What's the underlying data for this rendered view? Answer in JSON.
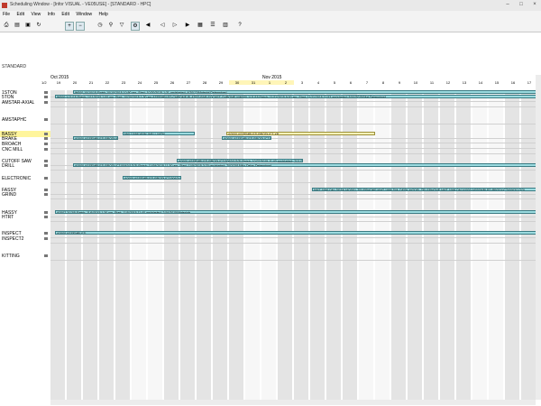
{
  "app": {
    "title": "Scheduling Window - [Infor VISUAL - VE05USE] - [STANDARD - HPC]"
  },
  "window_controls": {
    "minimize": "–",
    "maximize": "□",
    "close": "×"
  },
  "menu": [
    "File",
    "Edit",
    "View",
    "Info",
    "Edit",
    "Window",
    "Help"
  ],
  "toolbar": {
    "icons": [
      "print",
      "open",
      "save",
      "refresh",
      "zoom-in",
      "zoom-out",
      "back",
      "forward",
      "find",
      "help"
    ],
    "help_glyph": "?"
  },
  "calendar": {
    "label": "STANDARD",
    "scale": "1/2",
    "months": [
      {
        "name": "Oct 2015"
      },
      {
        "name": "Nov 2015"
      }
    ],
    "days": [
      "19",
      "20",
      "21",
      "22",
      "23",
      "24",
      "25",
      "26",
      "27",
      "28",
      "29",
      "30",
      "31",
      "1",
      "2",
      "3",
      "4",
      "5",
      "6",
      "7",
      "8",
      "9",
      "10",
      "11",
      "12",
      "13",
      "14",
      "15",
      "16",
      "17"
    ]
  },
  "rows": [
    "1STON",
    "5TON",
    "AMSTAR-AXIAL",
    "AMSTAPHC",
    "BASSY",
    "BRAKE",
    "BROACH",
    "CNC MILL",
    "CUTOFF SAW",
    "DRILL",
    "ELECTRONIC",
    "FASSY",
    "GRIND",
    "HASSY",
    "HTRT",
    "INSPECT",
    "INSPECT2",
    "KITTING"
  ],
  "bars": [
    {
      "row": 0,
      "label": "W000-10/10/15 Finish 10/10/2015 10:50 am, Start: 10/20/2015 1:31 am/started: 4/20/12/Material   Determined"
    },
    {
      "row": 1,
      "label": "W000-1/11/15 Finish: 1/11/2015 1:00 am, Start: 10/20/2015 1:30 am  ASSEMBLED CHROME PLATED BAR  SOCKET CHROME  NW000-1/11/15 Finish: 11/11/2015 9:00 am, Start: 11/11/2015 11:53 am/started: 5/16/2015/Mat Determined"
    },
    {
      "row": 4,
      "label": "NW-10/96 W/W: WALL WON"
    },
    {
      "row": 4,
      "label": "A0000 ASSEMBLED PRODUCT XB"
    },
    {
      "row": 5,
      "label": "A0000 ASSEMBLED PRODUCT(0063) Finish: 10/30/2015 3:30 pm, Start"
    },
    {
      "row": 5,
      "label": "A0000 ASSEMBLED PRODUCT(0063/1/2/3)"
    },
    {
      "row": 8,
      "label": "A0000 ASSEMBLED PRODUCT(0063/1/2/3) Finish: 10/27/2015 11:40 am/started: 7/11/2015/Material"
    },
    {
      "row": 9,
      "label": "A0000 ASSEMBLED PROD"
    },
    {
      "row": 9,
      "label": "A0000 ASSEMBLED PRODUCT(0063/1/2/3) Finish: 11/09/2015 11:30 am, Start: 11/5/2015 3:20 pm/started: 7/02/2015/No Delay Determined"
    },
    {
      "row": 10,
      "label": "A0000 ASSEMBLED PRODUCT(0063) Finish: 10/21/2015 12:00 am/started: 5/18/2015/Material FLAT  Determined"
    },
    {
      "row": 11,
      "label": "NMT 1996 DM: DESK MODEL TELEPHONE  NMT 1996 DM: DESK MODEL TELEPHONE  NMT 1996 DM  A0000 ASSEMBLED PRODUCT(0063/1/2/3)"
    },
    {
      "row": 13,
      "label": "A0007 2/13/5 Finish: 11/6/2015 1:30 pm, Start: 11/5/2015 11:40 am/started: 2/16/2015/Materials"
    },
    {
      "row": 15,
      "label": "A0000 ASSEMBLED"
    }
  ],
  "colors": {
    "bar_fill": "#9cdbe0",
    "bar_border": "#3a7b83",
    "highlight": "#fff59c",
    "grid": "#d0d0d0",
    "today": "#fff5b8"
  }
}
